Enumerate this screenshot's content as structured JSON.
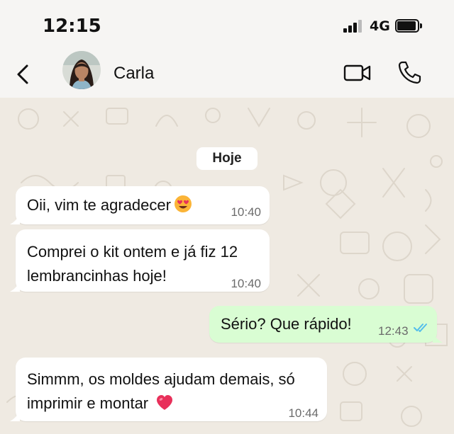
{
  "status_bar": {
    "time": "12:15",
    "network": "4G"
  },
  "header": {
    "contact_name": "Carla"
  },
  "chat": {
    "date_label": "Hoje",
    "messages": [
      {
        "direction": "in",
        "lines": [
          "Oii, vim te agradecer"
        ],
        "emoji": "heart-eyes-emoji",
        "time": "10:40"
      },
      {
        "direction": "in",
        "lines": [
          "Comprei o kit ontem e já fiz 12",
          "lembrancinhas hoje!"
        ],
        "time": "10:40"
      },
      {
        "direction": "out",
        "lines": [
          "Sério? Que rápido!"
        ],
        "time": "12:43",
        "status": "read"
      },
      {
        "direction": "in",
        "lines": [
          "Simmm, os moldes ajudam demais, só",
          "imprimir e montar"
        ],
        "emoji": "heart-emoji",
        "time": "10:44"
      }
    ]
  },
  "colors": {
    "incoming_bubble": "#ffffff",
    "outgoing_bubble": "#d9fdd3",
    "wallpaper": "#efeae2",
    "read_ticks": "#53bdeb",
    "heart": "#e8305a"
  }
}
